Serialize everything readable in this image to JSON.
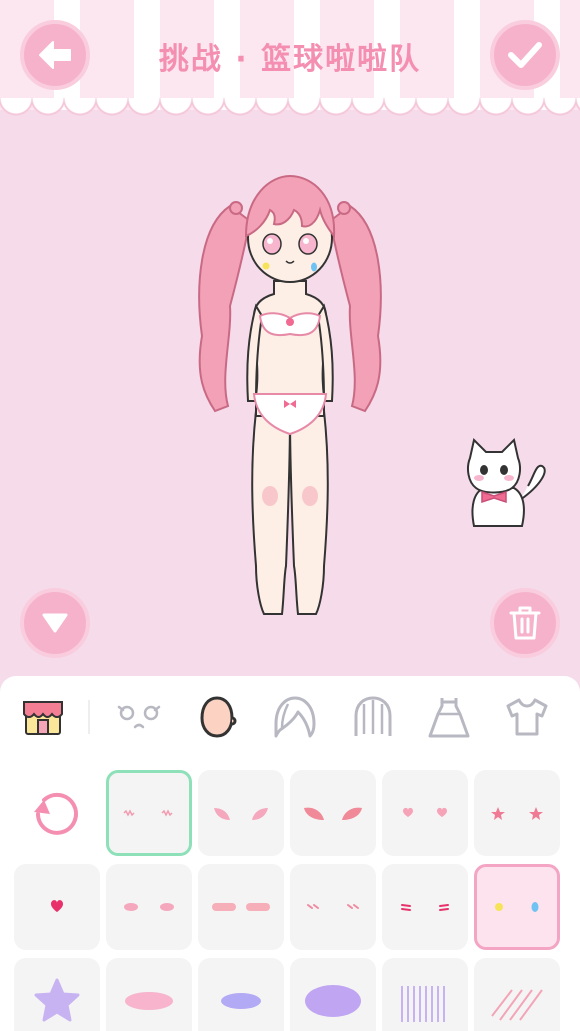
{
  "header": {
    "title": "挑战 · 篮球啦啦队",
    "back_icon": "arrow-left-icon",
    "confirm_icon": "check-icon"
  },
  "stage": {
    "collapse_icon": "triangle-down-icon",
    "trash_icon": "trash-icon"
  },
  "tabs": [
    {
      "name": "shop",
      "icon": "shop-icon"
    },
    {
      "name": "face-features",
      "icon": "face-features-icon"
    },
    {
      "name": "skin",
      "icon": "head-icon"
    },
    {
      "name": "front-hair",
      "icon": "front-hair-icon"
    },
    {
      "name": "back-hair",
      "icon": "back-hair-icon"
    },
    {
      "name": "dress",
      "icon": "dress-icon"
    },
    {
      "name": "top",
      "icon": "shirt-icon"
    }
  ],
  "grid": {
    "reset_icon": "reset-icon",
    "selected": [
      "blush-lines",
      "face-paint"
    ]
  },
  "colors": {
    "accent_pink": "#f48fb1",
    "background": "#f6dbea",
    "selected_green": "#8ee0b9",
    "selected_pink": "#f3a5c3"
  }
}
